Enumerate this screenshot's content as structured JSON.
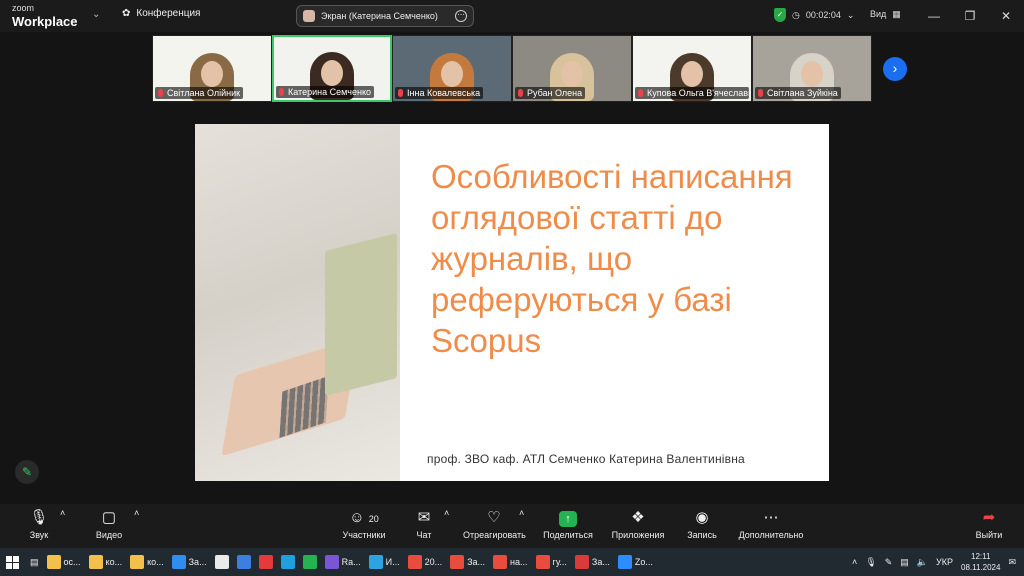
{
  "app": {
    "logo_small": "zoom",
    "logo_big": "Workplace",
    "meeting_label": "Конференция",
    "share_label": "Экран (Катерина Семченко)",
    "timer": "00:02:04",
    "view_label": "Вид"
  },
  "participants": [
    {
      "name": "Світлана Олійник",
      "bg": "#f4f4ef",
      "hair": "#8a6a45"
    },
    {
      "name": "Катерина Семченко",
      "bg": "#f2f3ef",
      "hair": "#3a2a22"
    },
    {
      "name": "Інна Ковалевська",
      "bg": "#5b6a74",
      "hair": "#c47a3c"
    },
    {
      "name": "Рубан Олена",
      "bg": "#8d8a84",
      "hair": "#d8c29c"
    },
    {
      "name": "Купова Ольга В'ячеславівна",
      "bg": "#f3f3ef",
      "hair": "#4c3a2a"
    },
    {
      "name": "Світлана Зуйкіна",
      "bg": "#a7a39a",
      "hair": "#d7d3c8"
    }
  ],
  "slide": {
    "title": "Особливості написання оглядової статті до журналів, що реферуються у базі Scopus",
    "author": "проф. ЗВО каф. АТЛ Семченко Катерина Валентинівна"
  },
  "controls": {
    "audio": "Звук",
    "video": "Видео",
    "participants": "Участники",
    "participants_count": "20",
    "chat": "Чат",
    "react": "Отреагировать",
    "share": "Поделиться",
    "apps": "Приложения",
    "record": "Запись",
    "more": "Дополнительно",
    "leave": "Выйти"
  },
  "taskbar": {
    "items": [
      {
        "label": "ос...",
        "color": "#f3c14b"
      },
      {
        "label": "ко...",
        "color": "#f3c14b"
      },
      {
        "label": "ко...",
        "color": "#f3c14b"
      },
      {
        "label": "За...",
        "color": "#2f8df0"
      },
      {
        "label": "",
        "color": "#e8eaec"
      },
      {
        "label": "",
        "color": "#3b7fe0"
      },
      {
        "label": "",
        "color": "#e43a3a"
      },
      {
        "label": "",
        "color": "#1fa0e0"
      },
      {
        "label": "",
        "color": "#25b352"
      },
      {
        "label": "Ra...",
        "color": "#7c55d6"
      },
      {
        "label": "И...",
        "color": "#2ea3e3"
      },
      {
        "label": "20...",
        "color": "#e74c3c"
      },
      {
        "label": "За...",
        "color": "#e74c3c"
      },
      {
        "label": "на...",
        "color": "#e74c3c"
      },
      {
        "label": "гу...",
        "color": "#e74c3c"
      },
      {
        "label": "За...",
        "color": "#d93a3a"
      },
      {
        "label": "Zo...",
        "color": "#2d8cff"
      }
    ],
    "lang": "УКР",
    "time": "12:11",
    "date": "08.11.2024"
  }
}
